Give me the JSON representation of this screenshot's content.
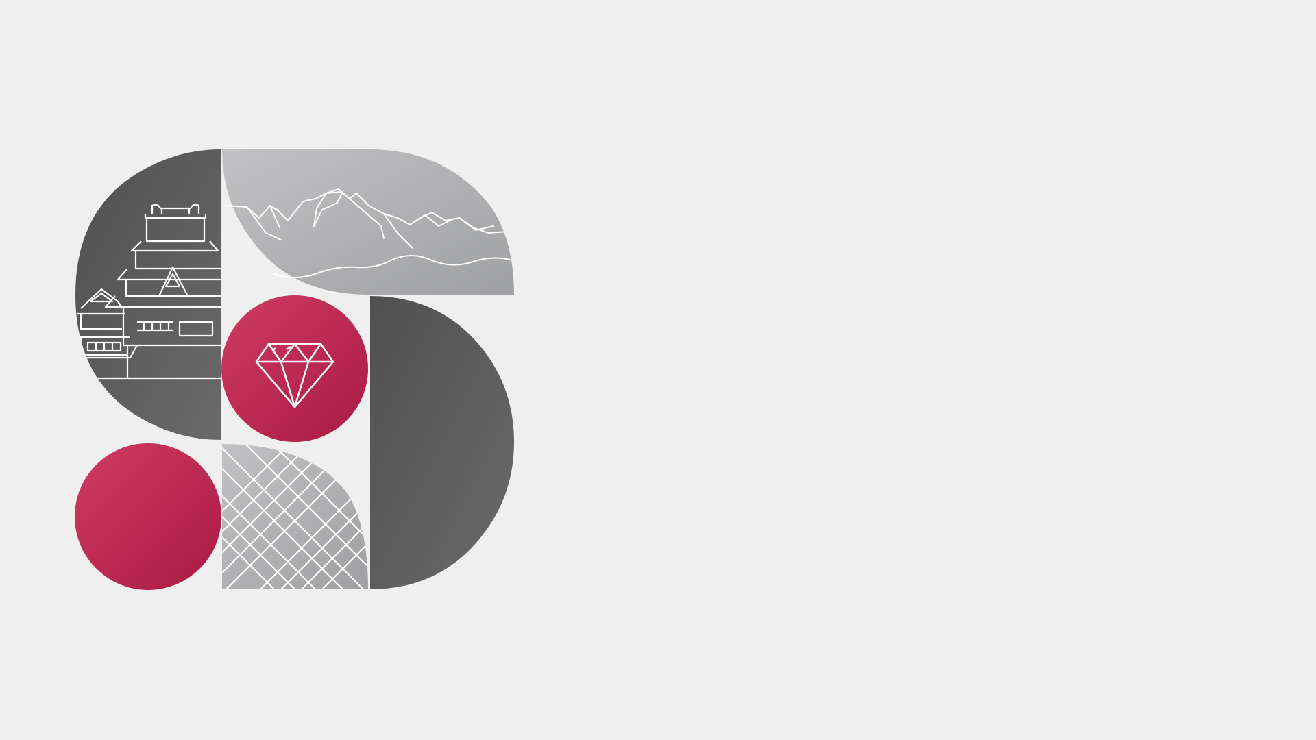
{
  "background": {
    "color": "#efefef"
  },
  "logo": {
    "icons": [
      "castle-icon",
      "mountains-icon",
      "diamond-icon"
    ],
    "colors": {
      "dark_gray": "#5f5f60",
      "light_gray": "#b4b4b6",
      "crimson": "#c0264f",
      "crimson_light": "#cf3b63",
      "line_white": "#ffffff"
    }
  }
}
